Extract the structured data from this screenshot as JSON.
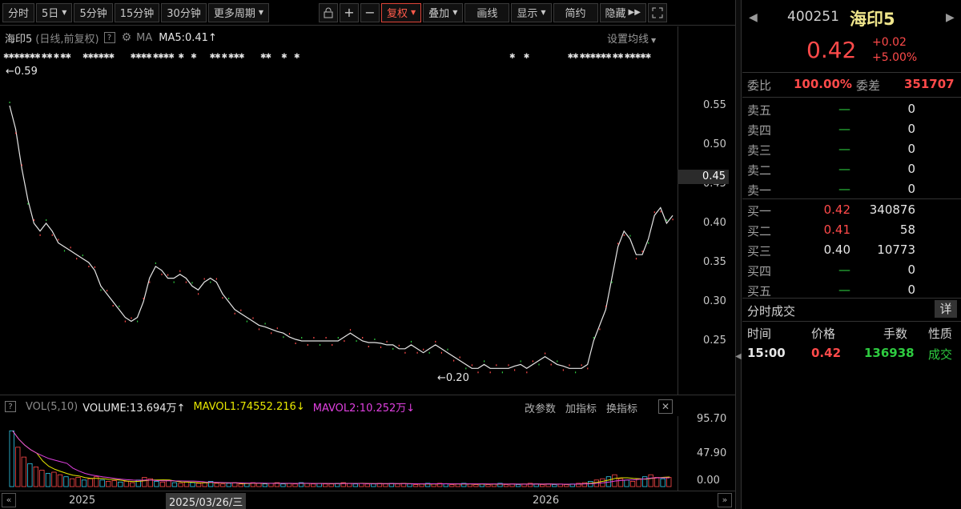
{
  "toolbar": {
    "items": [
      "分时",
      "5日",
      "5分钟",
      "15分钟",
      "30分钟",
      "更多周期"
    ],
    "fq": "复权",
    "overlay": "叠加",
    "draw": "画线",
    "display": "显示",
    "simple": "简约",
    "hide": "隐藏"
  },
  "chart_header": {
    "name": "海印5",
    "subtitle": "(日线,前复权)",
    "help": "?",
    "ma_label": "MA",
    "ma5": "MA5:0.41",
    "ma_arrow": "↑",
    "set_ma": "设置均线"
  },
  "chart_data": {
    "type": "line",
    "series": [
      {
        "values": [
          0.55,
          0.52,
          0.47,
          0.43,
          0.4,
          0.39,
          0.4,
          0.39,
          0.375,
          0.37,
          0.365,
          0.36,
          0.355,
          0.35,
          0.34,
          0.32,
          0.31,
          0.3,
          0.29,
          0.28,
          0.275,
          0.28,
          0.3,
          0.33,
          0.345,
          0.34,
          0.33,
          0.33,
          0.335,
          0.33,
          0.32,
          0.315,
          0.325,
          0.33,
          0.325,
          0.31,
          0.3,
          0.29,
          0.285,
          0.28,
          0.275,
          0.27,
          0.268,
          0.265,
          0.262,
          0.26,
          0.255,
          0.252,
          0.25,
          0.25,
          0.25,
          0.25,
          0.25,
          0.25,
          0.25,
          0.255,
          0.26,
          0.255,
          0.25,
          0.248,
          0.248,
          0.247,
          0.245,
          0.245,
          0.24,
          0.24,
          0.245,
          0.24,
          0.235,
          0.24,
          0.245,
          0.24,
          0.235,
          0.23,
          0.225,
          0.22,
          0.215,
          0.215,
          0.22,
          0.215,
          0.215,
          0.215,
          0.215,
          0.218,
          0.22,
          0.215,
          0.22,
          0.225,
          0.23,
          0.225,
          0.22,
          0.218,
          0.215,
          0.215,
          0.215,
          0.22,
          0.25,
          0.27,
          0.29,
          0.33,
          0.37,
          0.39,
          0.38,
          0.36,
          0.36,
          0.38,
          0.41,
          0.42,
          0.4,
          0.41
        ]
      }
    ],
    "ylim": [
      0.19,
      0.6
    ],
    "yticks": [
      "0.55",
      "0.50",
      "0.45",
      "0.40",
      "0.35",
      "0.30",
      "0.25"
    ],
    "current_price_label": "0.45",
    "max_label": "←0.59",
    "min_label": "←0.20",
    "x_labels": [
      "2025",
      "2026"
    ]
  },
  "volume": {
    "label": "VOL(5,10)",
    "volume": "VOLUME:13.694万",
    "volume_arrow": "↑",
    "mavol1": "MAVOL1:74552.216",
    "mavol1_arrow": "↓",
    "mavol2": "MAVOL2:10.252万",
    "mavol2_arrow": "↓",
    "tools": [
      "改参数",
      "加指标",
      "换指标"
    ],
    "yticks": [
      "95.70",
      "47.90",
      "0.00"
    ],
    "bars": [
      0.85,
      0.6,
      0.45,
      0.35,
      0.3,
      0.25,
      0.2,
      0.22,
      0.18,
      0.15,
      0.12,
      0.14,
      0.1,
      0.12,
      0.15,
      0.1,
      0.08,
      0.09,
      0.07,
      0.08,
      0.06,
      0.1,
      0.14,
      0.12,
      0.08,
      0.07,
      0.09,
      0.06,
      0.05,
      0.07,
      0.06,
      0.05,
      0.06,
      0.08,
      0.05,
      0.04,
      0.05,
      0.06,
      0.04,
      0.05,
      0.06,
      0.05,
      0.04,
      0.05,
      0.06,
      0.04,
      0.05,
      0.04,
      0.06,
      0.05,
      0.04,
      0.05,
      0.04,
      0.04,
      0.05,
      0.06,
      0.05,
      0.04,
      0.05,
      0.04,
      0.04,
      0.05,
      0.04,
      0.05,
      0.04,
      0.05,
      0.04,
      0.03,
      0.04,
      0.05,
      0.04,
      0.05,
      0.04,
      0.03,
      0.04,
      0.05,
      0.04,
      0.03,
      0.04,
      0.03,
      0.04,
      0.05,
      0.03,
      0.04,
      0.03,
      0.04,
      0.05,
      0.04,
      0.03,
      0.04,
      0.03,
      0.04,
      0.03,
      0.04,
      0.05,
      0.06,
      0.08,
      0.1,
      0.12,
      0.15,
      0.18,
      0.12,
      0.1,
      0.08,
      0.12,
      0.15,
      0.18,
      0.14,
      0.12,
      0.14
    ]
  },
  "date_axis": {
    "year1": "2025",
    "cursor": "2025/03/26/三",
    "year2": "2026"
  },
  "quote": {
    "code": "400251",
    "name": "海印5",
    "price": "0.42",
    "change": "+0.02",
    "change_pct": "+5.00%",
    "weibi_label": "委比",
    "weibi": "100.00%",
    "weicha_label": "委差",
    "weicha": "351707",
    "sell": [
      {
        "label": "卖五",
        "price": "—",
        "qty": "0"
      },
      {
        "label": "卖四",
        "price": "—",
        "qty": "0"
      },
      {
        "label": "卖三",
        "price": "—",
        "qty": "0"
      },
      {
        "label": "卖二",
        "price": "—",
        "qty": "0"
      },
      {
        "label": "卖一",
        "price": "—",
        "qty": "0"
      }
    ],
    "buy": [
      {
        "label": "买一",
        "price": "0.42",
        "qty": "340876"
      },
      {
        "label": "买二",
        "price": "0.41",
        "qty": "58"
      },
      {
        "label": "买三",
        "price": "0.40",
        "qty": "10773"
      },
      {
        "label": "买四",
        "price": "—",
        "qty": "0"
      },
      {
        "label": "买五",
        "price": "—",
        "qty": "0"
      }
    ],
    "trade_title": "分时成交",
    "detail": "详",
    "headers": [
      "时间",
      "价格",
      "手数",
      "性质"
    ],
    "trade": {
      "time": "15:00",
      "price": "0.42",
      "qty": "136938",
      "type": "成交"
    }
  },
  "colors": {
    "up": "#ff4a4a",
    "down": "#2ecc40",
    "line": "#e6e6e6",
    "name": "#f0e68c"
  }
}
